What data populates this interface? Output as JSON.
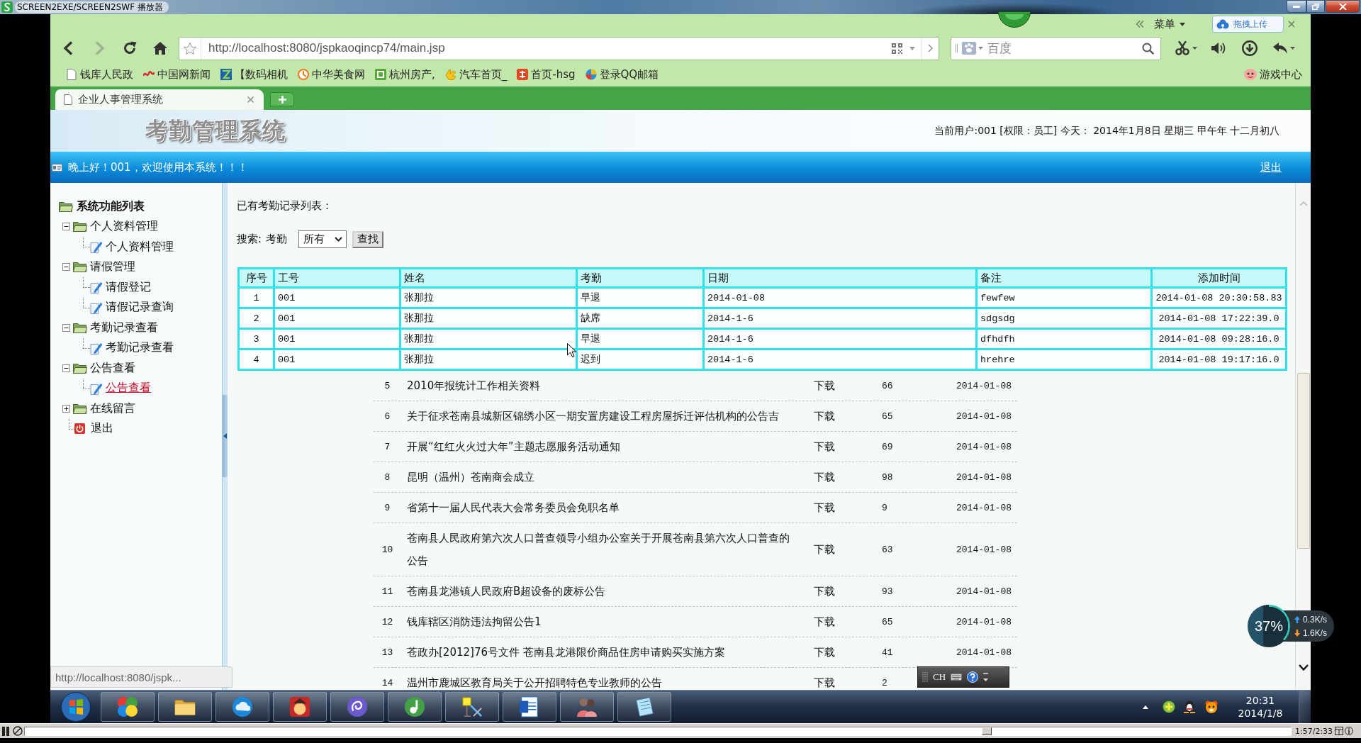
{
  "player": {
    "title": "SCREEN2EXE/SCREEN2SWF 播放器",
    "controls": {
      "playing": true,
      "level": 0.76,
      "time": "1:57/2:33"
    }
  },
  "browser": {
    "menu_label": "菜单",
    "upload_badge": "拖拽上传",
    "nav": {
      "can_go_back": true,
      "can_go_forward": false
    },
    "address": {
      "value": "http://localhost:8080/jspkaoqincp74/main.jsp"
    },
    "search": {
      "placeholder": "百度"
    },
    "bookmarks": [
      {
        "label": "钱库人民政"
      },
      {
        "label": "中国网新闻"
      },
      {
        "label": "【数码相机"
      },
      {
        "label": "中华美食网"
      },
      {
        "label": "杭州房产,"
      },
      {
        "label": "汽车首页_"
      },
      {
        "label": "首页-hsg"
      },
      {
        "label": "登录QQ邮箱"
      }
    ],
    "game_center": "游戏中心",
    "tabs": [
      {
        "label": "企业人事管理系统",
        "selected": true
      }
    ],
    "status_url": "http://localhost:8080/jspk..."
  },
  "page": {
    "logo": "考勤管理系统",
    "user_info": "当前用户:001 [权限：员工] 今天： 2014年1月8日 星期三 甲午年 十二月初八",
    "greeting": "晚上好！001，欢迎使用本系统！！！",
    "logout": "退出",
    "sidebar": {
      "title": "系统功能列表",
      "folders": [
        {
          "label": "个人资料管理",
          "expanded": true,
          "children": [
            {
              "label": "个人资料管理",
              "selected": false
            }
          ]
        },
        {
          "label": "请假管理",
          "expanded": true,
          "children": [
            {
              "label": "请假登记",
              "selected": false
            },
            {
              "label": "请假记录查询",
              "selected": false
            }
          ]
        },
        {
          "label": "考勤记录查看",
          "expanded": true,
          "children": [
            {
              "label": "考勤记录查看",
              "selected": false
            }
          ]
        },
        {
          "label": "公告查看",
          "expanded": true,
          "children": [
            {
              "label": "公告查看",
              "selected": true
            }
          ]
        },
        {
          "label": "在线留言",
          "expanded": false
        }
      ],
      "exit": "退出"
    },
    "records": {
      "heading": "已有考勤记录列表：",
      "search_label": "搜索:",
      "filter_label": "考勤",
      "filter_value": "所有",
      "search_button": "查找",
      "table": {
        "columns": [
          "序号",
          "工号",
          "姓名",
          "考勤",
          "日期",
          "备注",
          "添加时间"
        ],
        "rows": [
          [
            "1",
            "001",
            "张那拉",
            "早退",
            "2014-01-08",
            "fewfew",
            "2014-01-08 20:30:58.83"
          ],
          [
            "2",
            "001",
            "张那拉",
            "缺席",
            "2014-1-6",
            "sdgsdg",
            "2014-01-08 17:22:39.0"
          ],
          [
            "3",
            "001",
            "张那拉",
            "早退",
            "2014-1-6",
            "dfhdfh",
            "2014-01-08 09:28:16.0"
          ],
          [
            "4",
            "001",
            "张那拉",
            "迟到",
            "2014-1-6",
            "hrehre",
            "2014-01-08 19:17:16.0"
          ]
        ]
      }
    },
    "notices": [
      {
        "no": "5",
        "title": "2010年报统计工作相关资料",
        "action": "下载",
        "count": "66",
        "date": "2014-01-08"
      },
      {
        "no": "6",
        "title": "关于征求苍南县城新区锦绣小区一期安置房建设工程房屋拆迁评估机构的公告吉",
        "action": "下载",
        "count": "65",
        "date": "2014-01-08"
      },
      {
        "no": "7",
        "title": "开展“红红火火过大年”主题志愿服务活动通知",
        "action": "下载",
        "count": "69",
        "date": "2014-01-08"
      },
      {
        "no": "8",
        "title": "昆明（温州）苍南商会成立",
        "action": "下载",
        "count": "98",
        "date": "2014-01-08"
      },
      {
        "no": "9",
        "title": "省第十一届人民代表大会常务委员会免职名单",
        "action": "下载",
        "count": "9",
        "date": "2014-01-08"
      },
      {
        "no": "10",
        "title": "苍南县人民政府第六次人口普查领导小组办公室关于开展苍南县第六次人口普查的公告",
        "action": "下载",
        "count": "63",
        "date": "2014-01-08"
      },
      {
        "no": "11",
        "title": "苍南县龙港镇人民政府B超设备的废标公告",
        "action": "下载",
        "count": "93",
        "date": "2014-01-08"
      },
      {
        "no": "12",
        "title": "钱库辖区消防违法拘留公告1",
        "action": "下载",
        "count": "65",
        "date": "2014-01-08"
      },
      {
        "no": "13",
        "title": "苍政办[2012]76号文件 苍南县龙港限价商品住房申请购买实施方案",
        "action": "下载",
        "count": "41",
        "date": "2014-01-08"
      },
      {
        "no": "14",
        "title": "温州市鹿城区教育局关于公开招聘特色专业教师的公告",
        "action": "下载",
        "count": "2"
      }
    ]
  },
  "taskbar": {
    "time": "20:31",
    "date": "2014/1/8"
  },
  "overlays": {
    "ime": {
      "language": "CH"
    },
    "network": {
      "percent": "37%",
      "level": 0.37,
      "upload": "0.3K/s",
      "download": "1.6K/s"
    }
  }
}
